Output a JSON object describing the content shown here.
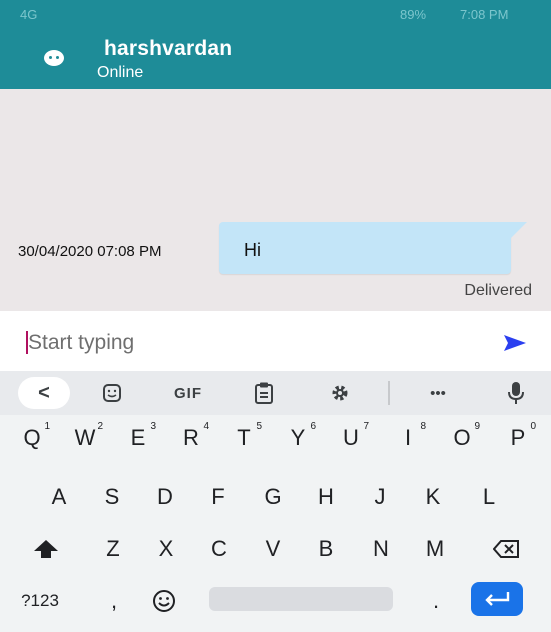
{
  "status_bar": {
    "left": "4G",
    "right": "7:08 PM",
    "battery": "89%"
  },
  "header": {
    "contact_name": "harshvardan",
    "status": "Online"
  },
  "chat": {
    "messages": [
      {
        "timestamp": "30/04/2020 07:08 PM",
        "text": "Hi",
        "receipt": "Delivered"
      }
    ]
  },
  "composer": {
    "placeholder": "Start typing",
    "value": ""
  },
  "keyboard": {
    "toolbar": {
      "back": "<",
      "gif": "GIF",
      "more": "•••"
    },
    "row1": [
      {
        "key": "Q",
        "hint": "1"
      },
      {
        "key": "W",
        "hint": "2"
      },
      {
        "key": "E",
        "hint": "3"
      },
      {
        "key": "R",
        "hint": "4"
      },
      {
        "key": "T",
        "hint": "5"
      },
      {
        "key": "Y",
        "hint": "6"
      },
      {
        "key": "U",
        "hint": "7"
      },
      {
        "key": "I",
        "hint": "8"
      },
      {
        "key": "O",
        "hint": "9"
      },
      {
        "key": "P",
        "hint": "0"
      }
    ],
    "row2": [
      "A",
      "S",
      "D",
      "F",
      "G",
      "H",
      "J",
      "K",
      "L"
    ],
    "row3": [
      "Z",
      "X",
      "C",
      "V",
      "B",
      "N",
      "M"
    ],
    "row4": {
      "symbols": "?123",
      "comma": ",",
      "period": "."
    }
  },
  "colors": {
    "accent": "#1e8c98",
    "bubble": "#c3e5f8",
    "send": "#2b3ff0",
    "enter": "#1a73e8"
  }
}
